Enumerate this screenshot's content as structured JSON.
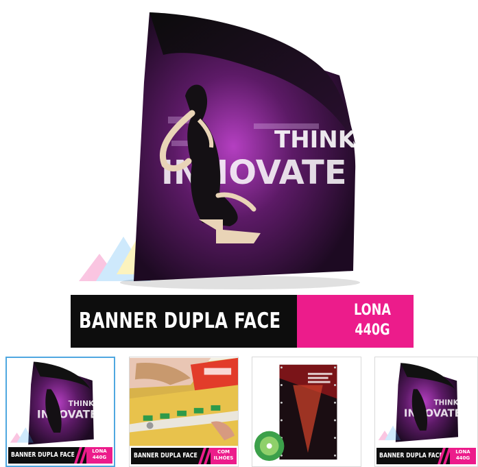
{
  "main": {
    "art_text": {
      "line1": "THINK",
      "line2": "INNOVATE"
    },
    "title": "BANNER DUPLA FACE",
    "tag_line1": "LONA",
    "tag_line2": "440G"
  },
  "thumbnails": [
    {
      "title": "BANNER DUPLA FACE",
      "tag_line1": "LONA",
      "tag_line2": "440G",
      "art_text": "INNOVATE",
      "art_text2": "THINK"
    },
    {
      "title": "BANNER DUPLA FACE",
      "tag_line1": "COM",
      "tag_line2": "ILHÓES",
      "art_text": "",
      "art_text2": ""
    },
    {
      "title": "",
      "tag_line1": "",
      "tag_line2": "",
      "art_text": "",
      "art_text2": ""
    },
    {
      "title": "BANNER DUPLA FACE",
      "tag_line1": "LONA",
      "tag_line2": "440G",
      "art_text": "INNOVATE",
      "art_text2": "THINK"
    }
  ],
  "colors": {
    "accent_pink": "#ec1c8b",
    "bar_black": "#0d0d0d",
    "active_border": "#4ea7e0",
    "banner_purple": "#3a1240"
  }
}
